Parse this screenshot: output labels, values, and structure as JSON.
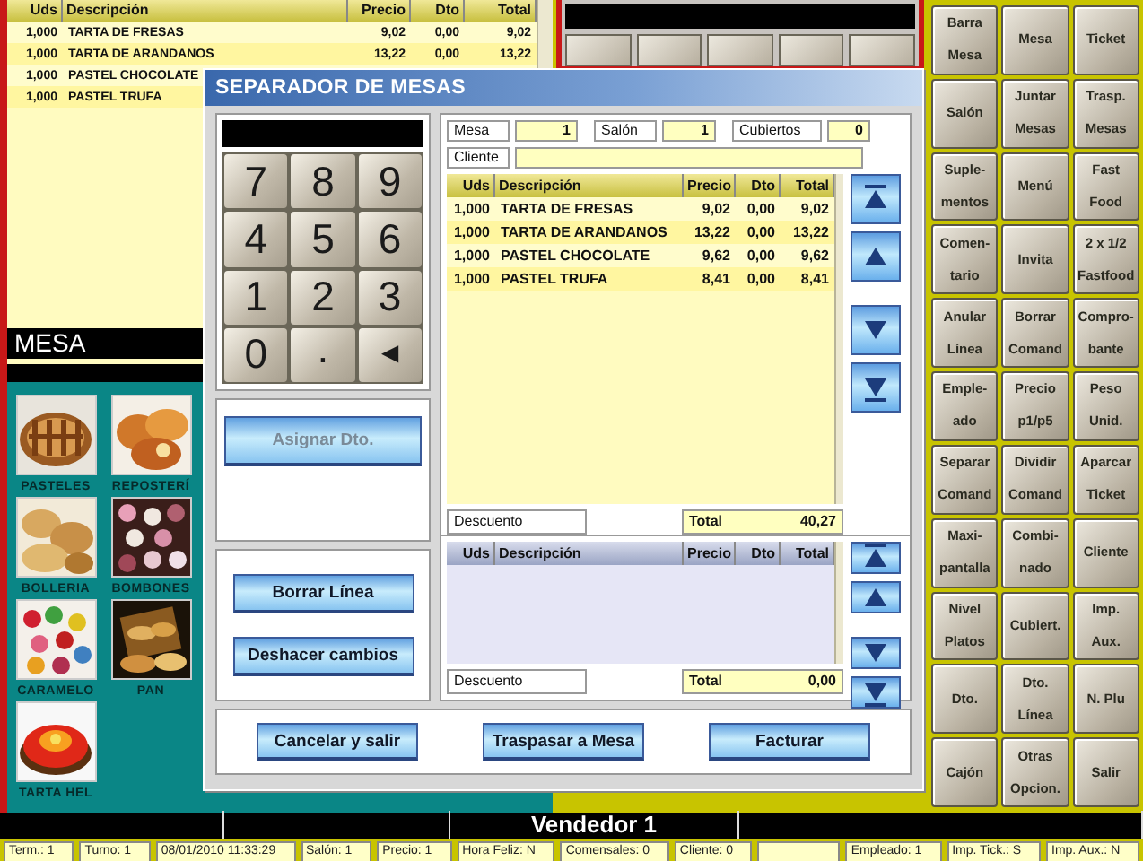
{
  "order_table": {
    "columns": [
      "Uds",
      "Descripción",
      "Precio",
      "Dto",
      "Total"
    ],
    "rows": [
      {
        "uds": "1,000",
        "descripcion": "TARTA DE FRESAS",
        "precio": "9,02",
        "dto": "0,00",
        "total": "9,02"
      },
      {
        "uds": "1,000",
        "descripcion": "TARTA DE ARANDANOS",
        "precio": "13,22",
        "dto": "0,00",
        "total": "13,22"
      },
      {
        "uds": "1,000",
        "descripcion": "PASTEL CHOCOLATE"
      },
      {
        "uds": "1,000",
        "descripcion": "PASTEL TRUFA"
      }
    ]
  },
  "table_label": "MESA",
  "categories": [
    {
      "label": "PASTELES"
    },
    {
      "label": "REPOSTERÍ"
    },
    {
      "label": "BOLLERIA"
    },
    {
      "label": "BOMBONES"
    },
    {
      "label": "CARAMELO"
    },
    {
      "label": "PAN"
    },
    {
      "label": "TARTA HEL"
    }
  ],
  "function_buttons": [
    {
      "label": "Barra\nMesa"
    },
    {
      "label": "Mesa"
    },
    {
      "label": "Ticket"
    },
    {
      "label": "Salón"
    },
    {
      "label": "Juntar\nMesas"
    },
    {
      "label": "Trasp.\nMesas"
    },
    {
      "label": "Suple-\nmentos"
    },
    {
      "label": "Menú"
    },
    {
      "label": "Fast\nFood"
    },
    {
      "label": "Comen-\ntario"
    },
    {
      "label": "Invita"
    },
    {
      "label": "2 x 1/2\nFastfood"
    },
    {
      "label": "Anular\nLínea"
    },
    {
      "label": "Borrar\nComand"
    },
    {
      "label": "Compro-\nbante"
    },
    {
      "label": "Emple-\nado"
    },
    {
      "label": "Precio\np1/p5"
    },
    {
      "label": "Peso\nUnid."
    },
    {
      "label": "Separar\nComand"
    },
    {
      "label": "Dividir\nComand"
    },
    {
      "label": "Aparcar\nTicket"
    },
    {
      "label": "Maxi-\npantalla"
    },
    {
      "label": "Combi-\nnado"
    },
    {
      "label": "Cliente"
    },
    {
      "label": "Nivel\nPlatos"
    },
    {
      "label": "Cubiert."
    },
    {
      "label": "Imp.\nAux."
    },
    {
      "label": "Dto."
    },
    {
      "label": "Dto.\nLínea"
    },
    {
      "label": "N. Plu"
    },
    {
      "label": "Cajón"
    },
    {
      "label": "Otras\nOpcion."
    },
    {
      "label": "Salir"
    }
  ],
  "vendor": "Vendedor 1",
  "status_bar": [
    {
      "text": "Term.: 1"
    },
    {
      "text": "Turno: 1"
    },
    {
      "text": "08/01/2010 11:33:29"
    },
    {
      "text": "Salón: 1"
    },
    {
      "text": "Precio: 1"
    },
    {
      "text": "Hora Feliz: N"
    },
    {
      "text": "Comensales: 0"
    },
    {
      "text": "Cliente: 0"
    },
    {
      "kind": "blank"
    },
    {
      "text": "Empleado: 1"
    },
    {
      "text": "Imp. Tick.: S"
    },
    {
      "text": "Imp. Aux.: N"
    }
  ],
  "dialog": {
    "title": "SEPARADOR DE MESAS",
    "keypad": [
      "7",
      "8",
      "9",
      "4",
      "5",
      "6",
      "1",
      "2",
      "3",
      "0",
      ".",
      "◄"
    ],
    "discount_button": {
      "label": "Asignar Dto.",
      "disabled": true
    },
    "line_buttons": [
      "Borrar Línea",
      "Deshacer cambios"
    ],
    "fields": [
      {
        "label": "Mesa",
        "value": "1"
      },
      {
        "label": "Salón",
        "value": "1"
      },
      {
        "label": "Cubiertos",
        "value": "0"
      }
    ],
    "cliente": {
      "label": "Cliente"
    },
    "source_table": {
      "columns": [
        "Uds",
        "Descripción",
        "Precio",
        "Dto",
        "Total"
      ],
      "rows": [
        {
          "uds": "1,000",
          "descripcion": "TARTA DE FRESAS",
          "precio": "9,02",
          "dto": "0,00",
          "total": "9,02"
        },
        {
          "uds": "1,000",
          "descripcion": "TARTA DE ARANDANOS",
          "precio": "13,22",
          "dto": "0,00",
          "total": "13,22"
        },
        {
          "uds": "1,000",
          "descripcion": "PASTEL CHOCOLATE",
          "precio": "9,62",
          "dto": "0,00",
          "total": "9,62"
        },
        {
          "uds": "1,000",
          "descripcion": "PASTEL TRUFA",
          "precio": "8,41",
          "dto": "0,00",
          "total": "8,41"
        }
      ],
      "discount_label": "Descuento",
      "total_label": "Total",
      "total": "40,27"
    },
    "target_table": {
      "columns": [
        "Uds",
        "Descripción",
        "Precio",
        "Dto",
        "Total"
      ],
      "discount_label": "Descuento",
      "total_label": "Total",
      "total": "0,00"
    },
    "actions": [
      "Cancelar y salir",
      "Traspasar a Mesa",
      "Facturar"
    ]
  }
}
